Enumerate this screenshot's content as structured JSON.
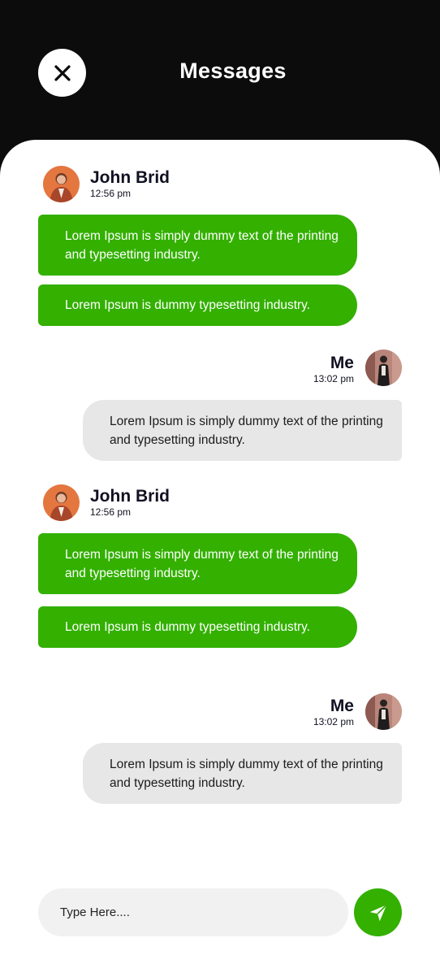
{
  "header": {
    "title": "Messages",
    "close_icon": "close-icon"
  },
  "messages": [
    {
      "sender": "John Brid",
      "time": "12:56 pm",
      "direction": "incoming",
      "bubbles": [
        "Lorem Ipsum is simply dummy text of the printing and typesetting industry.",
        "Lorem Ipsum is dummy typesetting industry."
      ]
    },
    {
      "sender": "Me",
      "time": "13:02 pm",
      "direction": "outgoing",
      "bubbles": [
        "Lorem Ipsum is simply dummy text of the printing and typesetting industry."
      ]
    },
    {
      "sender": "John Brid",
      "time": "12:56 pm",
      "direction": "incoming",
      "bubbles": [
        "Lorem Ipsum is simply dummy text of the printing and typesetting industry.",
        "Lorem Ipsum is dummy typesetting industry."
      ]
    },
    {
      "sender": "Me",
      "time": "13:02 pm",
      "direction": "outgoing",
      "bubbles": [
        "Lorem Ipsum is simply dummy text of the printing and typesetting industry."
      ]
    }
  ],
  "composer": {
    "placeholder": "Type Here....",
    "value": "",
    "send_icon": "send-icon"
  },
  "colors": {
    "header_bg": "#0c0c0c",
    "accent_green": "#33b000",
    "outgoing_bubble": "#e7e7e7",
    "input_bg": "#f1f1f1"
  }
}
